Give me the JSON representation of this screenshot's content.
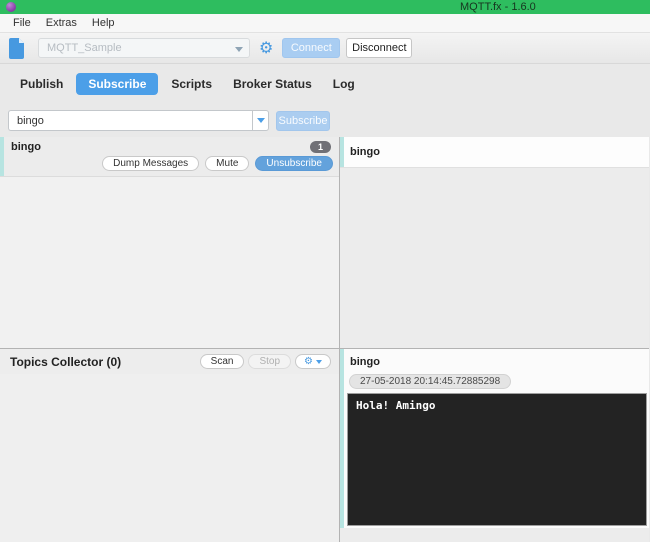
{
  "window": {
    "title": "MQTT.fx - 1.6.0"
  },
  "menu": {
    "items": [
      "File",
      "Extras",
      "Help"
    ]
  },
  "toolbar": {
    "profile_placeholder": "MQTT_Sample",
    "connect_label": "Connect",
    "disconnect_label": "Disconnect"
  },
  "tabs": [
    {
      "label": "Publish",
      "active": false
    },
    {
      "label": "Subscribe",
      "active": true
    },
    {
      "label": "Scripts",
      "active": false
    },
    {
      "label": "Broker Status",
      "active": false
    },
    {
      "label": "Log",
      "active": false
    }
  ],
  "subscribe_bar": {
    "topic_value": "bingo",
    "subscribe_label": "Subscribe"
  },
  "subscription_item": {
    "topic": "bingo",
    "message_count": "1",
    "dump_label": "Dump Messages",
    "mute_label": "Mute",
    "unsubscribe_label": "Unsubscribe"
  },
  "messages_panel": {
    "topic": "bingo"
  },
  "topics_collector": {
    "title": "Topics Collector (0)",
    "scan_label": "Scan",
    "stop_label": "Stop"
  },
  "message_detail": {
    "topic": "bingo",
    "timestamp": "27-05-2018 20:14:45.72885298",
    "payload": "Hola! Amingo"
  },
  "icons": {
    "gear_glyph": "⚙"
  },
  "colors": {
    "titlebar_green": "#2ebd5f",
    "accent_blue": "#4c9fe8",
    "disabled_blue": "#abcdf0",
    "unsubscribe_blue": "#63a2dc",
    "badge_gray": "#707076",
    "cyan_accent": "#b7e4e1",
    "terminal_bg": "#232323",
    "app_icon_purple": "#8e44ad"
  }
}
